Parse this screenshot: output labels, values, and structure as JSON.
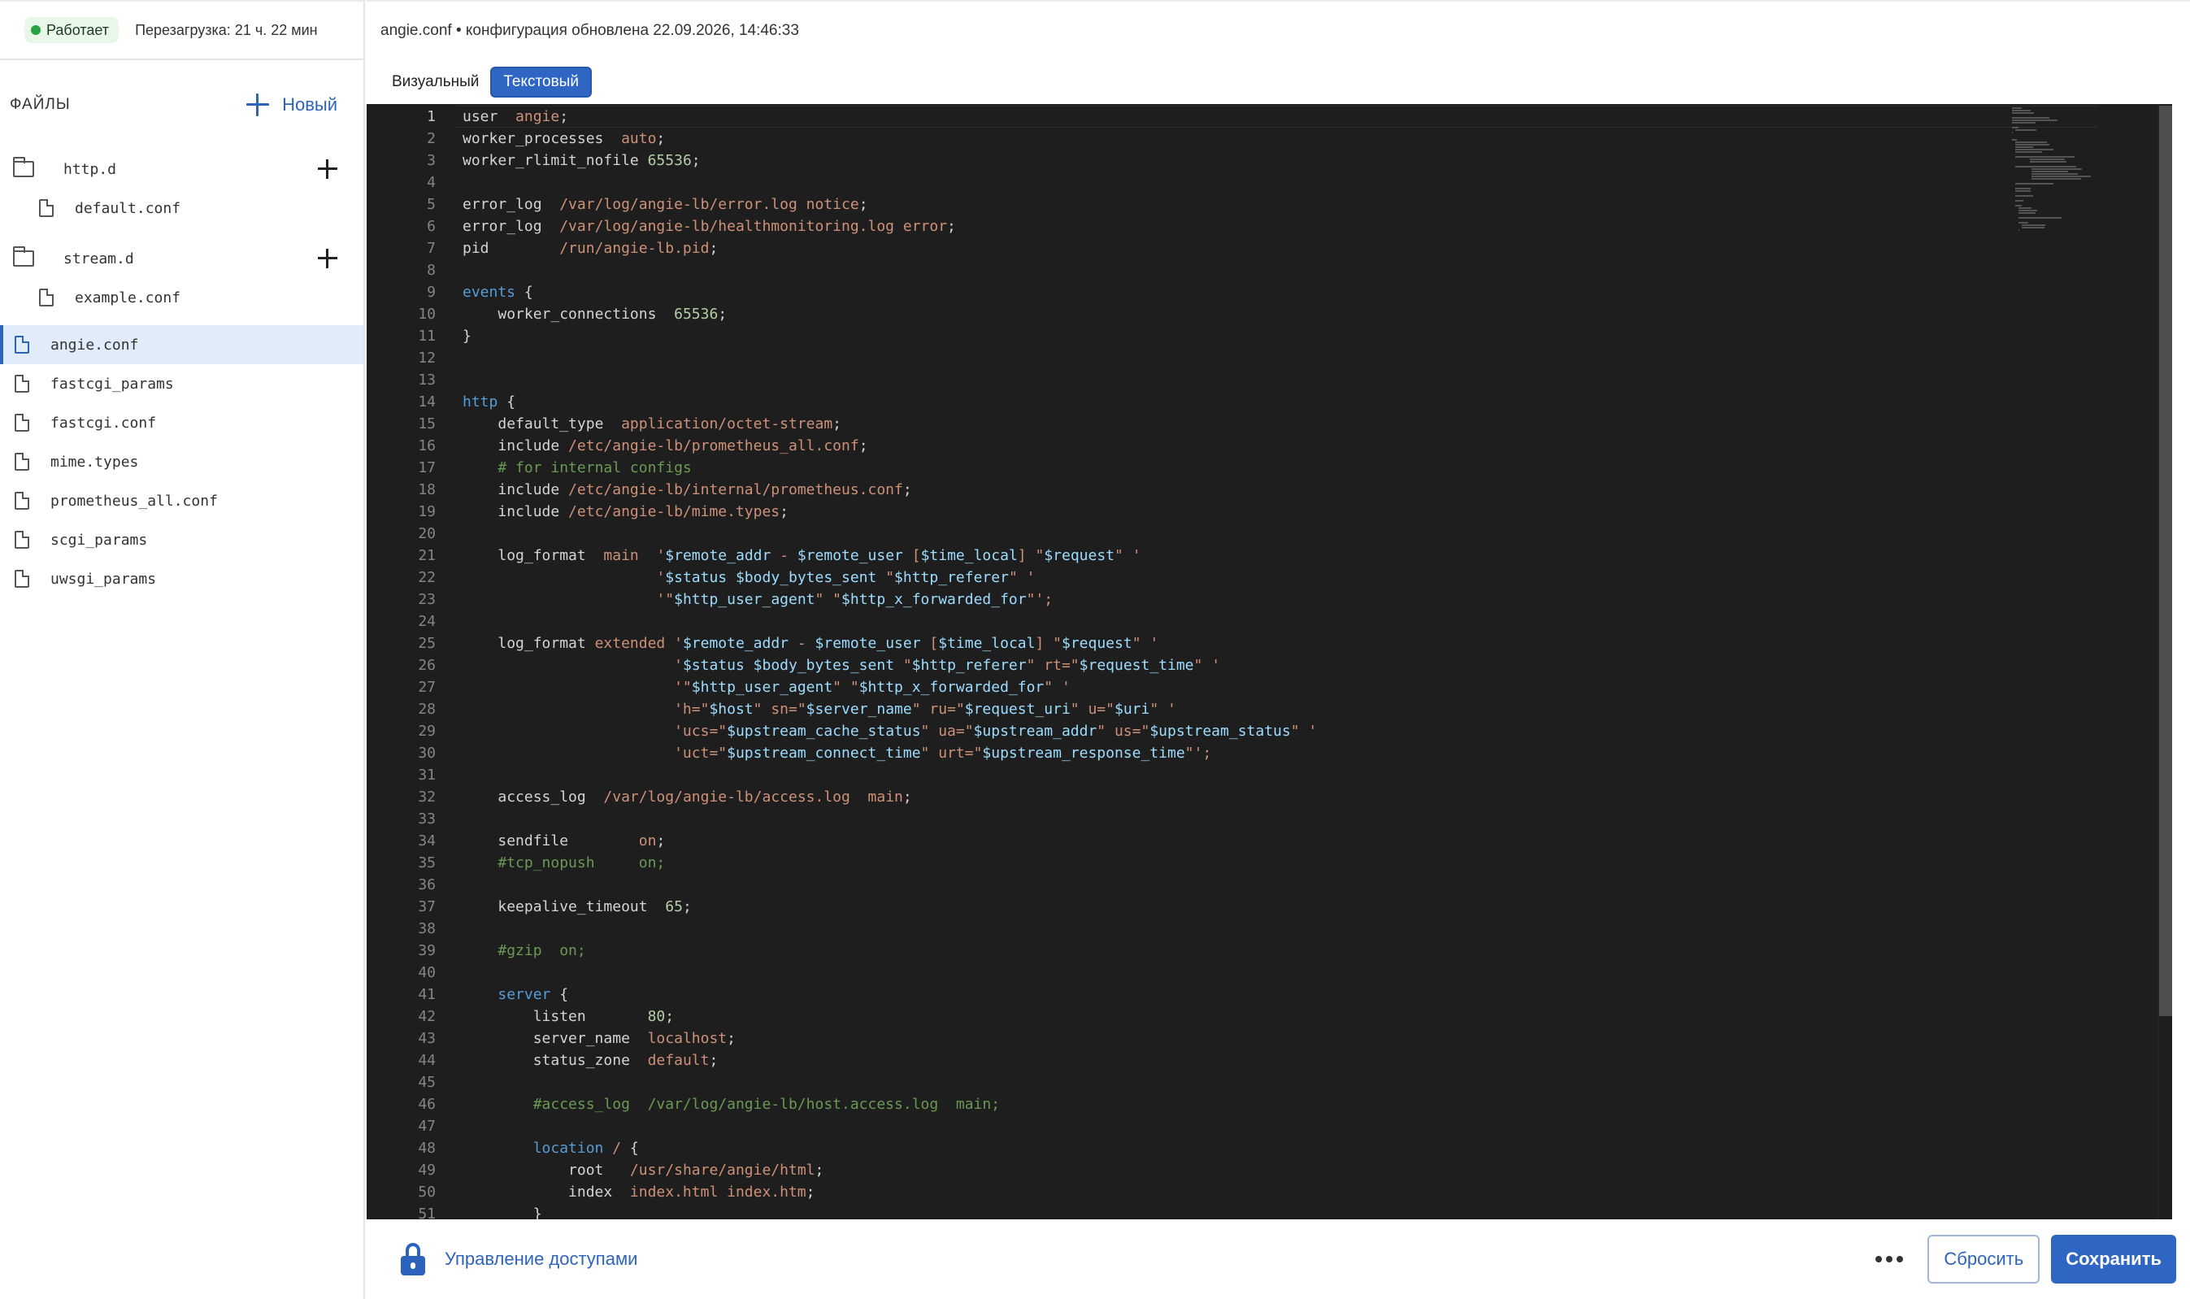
{
  "status": {
    "label": "Работает",
    "uptime": "Перезагрузка: 21 ч. 22 мин",
    "color": "#27a344"
  },
  "files": {
    "title": "ФАЙЛЫ",
    "new_label": "Новый",
    "folders": [
      {
        "name": "http.d",
        "children": [
          "default.conf"
        ]
      },
      {
        "name": "stream.d",
        "children": [
          "example.conf"
        ]
      }
    ],
    "root_files": [
      "angie.conf",
      "fastcgi_params",
      "fastcgi.conf",
      "mime.types",
      "prometheus_all.conf",
      "scgi_params",
      "uwsgi_params"
    ],
    "selected": "angie.conf"
  },
  "header": {
    "info": "angie.conf • конфигурация обновлена 22.09.2026, 14:46:33"
  },
  "tabs": {
    "visual": "Визуальный",
    "text": "Текстовый",
    "active": "Текстовый"
  },
  "editor": {
    "theme_colors": {
      "background": "#1e1e1e",
      "keyword": "#d4d4d4",
      "string": "#ce9178",
      "comment": "#6a9955",
      "variable": "#9cdcfe",
      "block": "#569cd6",
      "number": "#b5cea8"
    },
    "lines": [
      "user  angie;",
      "worker_processes  auto;",
      "worker_rlimit_nofile 65536;",
      "",
      "error_log  /var/log/angie-lb/error.log notice;",
      "error_log  /var/log/angie-lb/healthmonitoring.log error;",
      "pid        /run/angie-lb.pid;",
      "",
      "events {",
      "    worker_connections  65536;",
      "}",
      "",
      "",
      "http {",
      "    default_type  application/octet-stream;",
      "    include /etc/angie-lb/prometheus_all.conf;",
      "    # for internal configs",
      "    include /etc/angie-lb/internal/prometheus.conf;",
      "    include /etc/angie-lb/mime.types;",
      "",
      "    log_format  main  '$remote_addr - $remote_user [$time_local] \"$request\" '",
      "                      '$status $body_bytes_sent \"$http_referer\" '",
      "                      '\"$http_user_agent\" \"$http_x_forwarded_for\"';",
      "",
      "    log_format extended '$remote_addr - $remote_user [$time_local] \"$request\" '",
      "                        '$status $body_bytes_sent \"$http_referer\" rt=\"$request_time\" '",
      "                        '\"$http_user_agent\" \"$http_x_forwarded_for\" '",
      "                        'h=\"$host\" sn=\"$server_name\" ru=\"$request_uri\" u=\"$uri\" '",
      "                        'ucs=\"$upstream_cache_status\" ua=\"$upstream_addr\" us=\"$upstream_status\" '",
      "                        'uct=\"$upstream_connect_time\" urt=\"$upstream_response_time\"';",
      "",
      "    access_log  /var/log/angie-lb/access.log  main;",
      "",
      "    sendfile        on;",
      "    #tcp_nopush     on;",
      "",
      "    keepalive_timeout  65;",
      "",
      "    #gzip  on;",
      "",
      "    server {",
      "        listen       80;",
      "        server_name  localhost;",
      "        status_zone  default;",
      "",
      "        #access_log  /var/log/angie-lb/host.access.log  main;",
      "",
      "        location / {",
      "            root   /usr/share/angie/html;",
      "            index  index.html index.htm;",
      "        }"
    ]
  },
  "footer": {
    "access_label": "Управление доступами",
    "reset_label": "Сбросить",
    "save_label": "Сохранить"
  },
  "icons": {
    "new": "plus-icon",
    "folder": "folder-icon",
    "file": "file-icon",
    "access": "lock-icon",
    "more": "more-icon"
  },
  "accent_color": "#2c63bd"
}
